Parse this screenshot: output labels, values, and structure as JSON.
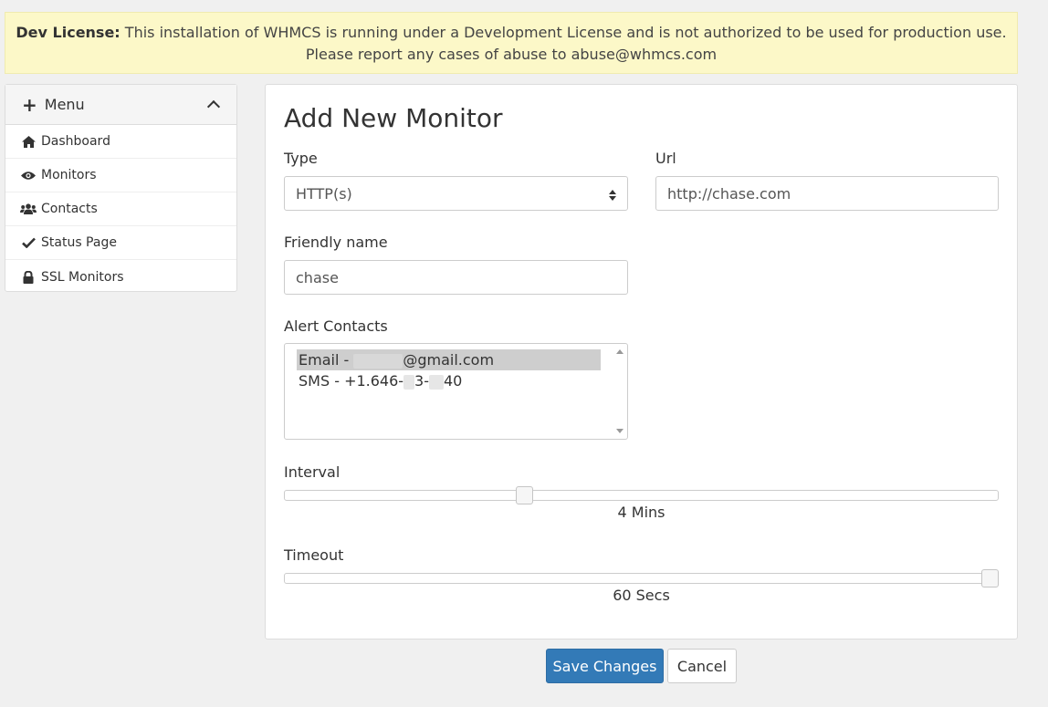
{
  "banner": {
    "strong": "Dev License:",
    "line1": " This installation of WHMCS is running under a Development License and is not authorized to be used for production use.",
    "line2": "Please report any cases of abuse to abuse@whmcs.com"
  },
  "sidebar": {
    "title": "Menu",
    "items": [
      {
        "label": "Dashboard",
        "icon": "home-icon"
      },
      {
        "label": "Monitors",
        "icon": "eye-icon"
      },
      {
        "label": "Contacts",
        "icon": "users-icon"
      },
      {
        "label": "Status Page",
        "icon": "check-icon"
      },
      {
        "label": "SSL Monitors",
        "icon": "lock-icon"
      }
    ]
  },
  "form": {
    "title": "Add New Monitor",
    "type_label": "Type",
    "type_value": "HTTP(s)",
    "url_label": "Url",
    "url_value": "http://chase.com",
    "friendly_label": "Friendly name",
    "friendly_value": "chase",
    "alert_label": "Alert Contacts",
    "alert_options": [
      {
        "prefix": "Email - ",
        "suffix": "@gmail.com",
        "selected": true
      },
      {
        "prefix": "SMS - +1.646-",
        "mid": "3-",
        "suffix": "40",
        "selected": false
      }
    ],
    "interval_label": "Interval",
    "interval_value": "4 Mins",
    "interval_fraction": 0.333,
    "timeout_label": "Timeout",
    "timeout_value": "60 Secs",
    "timeout_fraction": 1.0
  },
  "buttons": {
    "save": "Save Changes",
    "cancel": "Cancel"
  },
  "colors": {
    "banner_bg": "#fcf8c8",
    "primary": "#337ab7",
    "page_bg": "#f0f0f0"
  }
}
